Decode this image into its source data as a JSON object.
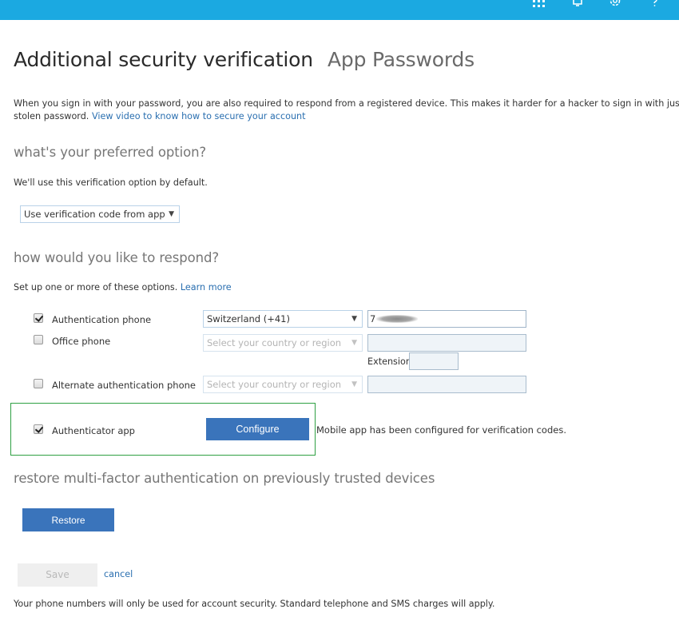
{
  "topbar": {
    "icons": [
      "app-launcher-icon",
      "bell-icon",
      "gear-icon",
      "help-icon"
    ],
    "color": "#1ba9e1"
  },
  "header": {
    "title": "Additional security verification",
    "tab_app_passwords": "App Passwords"
  },
  "intro": {
    "text_line1": "When you sign in with your password, you are also required to respond from a registered device. This makes it harder for a hacker to sign in with just a",
    "text_line2": "stolen password. ",
    "video_link": "View video to know how to secure your account"
  },
  "preferred": {
    "heading": "what's your preferred option?",
    "subtext": "We'll use this verification option by default.",
    "select_value": "Use verification code from app"
  },
  "respond": {
    "heading": "how would you like to respond?",
    "subtext": "Set up one or more of these options. ",
    "learn_more": "Learn more",
    "options": [
      {
        "label": "Authentication phone",
        "checked": true,
        "country": "Switzerland (+41)",
        "number_prefix": "7",
        "number_redacted": true
      },
      {
        "label": "Office phone",
        "checked": false,
        "country_placeholder": "Select your country or region",
        "number": "",
        "extension_label": "Extension",
        "extension": ""
      },
      {
        "label": "Alternate authentication phone",
        "checked": false,
        "country_placeholder": "Select your country or region",
        "number": ""
      },
      {
        "label": "Authenticator app",
        "checked": true,
        "button": "Configure",
        "status": "Mobile app has been configured for verification codes."
      }
    ]
  },
  "restore": {
    "heading": "restore multi-factor authentication on previously trusted devices",
    "button": "Restore"
  },
  "actions": {
    "save": "Save",
    "cancel": "cancel"
  },
  "footer": {
    "note": "Your phone numbers will only be used for account security. Standard telephone and SMS charges will apply."
  },
  "colors": {
    "accent_button": "#3a74bb",
    "link": "#2a6fb0",
    "highlight_border": "#2ea043"
  }
}
